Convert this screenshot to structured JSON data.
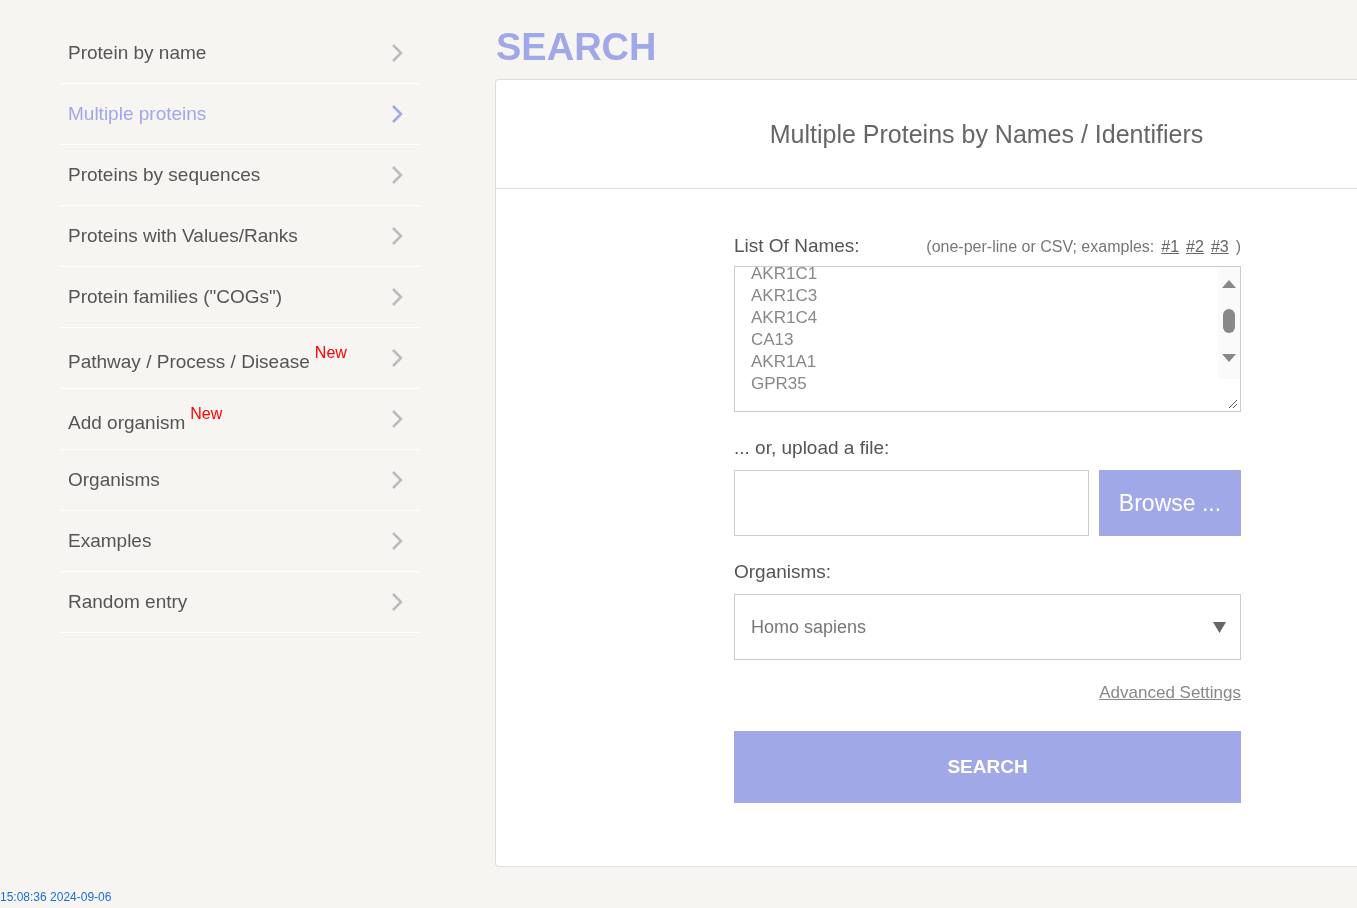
{
  "sidebar": {
    "items": [
      {
        "label": "Protein by name",
        "selected": false
      },
      {
        "label": "Multiple proteins",
        "selected": true
      },
      {
        "label": "Proteins by sequences",
        "selected": false
      },
      {
        "label": "Proteins with Values/Ranks",
        "selected": false
      },
      {
        "label": "Protein families (\"COGs\")",
        "selected": false
      },
      {
        "label": "Pathway / Process / Disease",
        "selected": false,
        "badge": "New"
      },
      {
        "label": "Add organism",
        "selected": false,
        "badge": "New"
      },
      {
        "label": "Organisms",
        "selected": false
      },
      {
        "label": "Examples",
        "selected": false
      },
      {
        "label": "Random entry",
        "selected": false
      }
    ]
  },
  "page_title": "SEARCH",
  "panel": {
    "title": "Multiple Proteins by Names / Identifiers",
    "names_label": "List Of Names:",
    "names_hint": "(one-per-line or CSV; examples:",
    "example_links": [
      "#1",
      "#2",
      "#3"
    ],
    "names_hint_end": ")",
    "names": [
      "AKR1C1",
      "AKR1C3",
      "AKR1C4",
      "CA13",
      "AKR1A1",
      "GPR35"
    ],
    "upload_label": "... or, upload a file:",
    "browse_button": "Browse ...",
    "organisms_label": "Organisms:",
    "organism": "Homo sapiens",
    "advanced_link": "Advanced Settings",
    "search_button": "SEARCH"
  },
  "timestamp": "15:08:36 2024-09-06"
}
